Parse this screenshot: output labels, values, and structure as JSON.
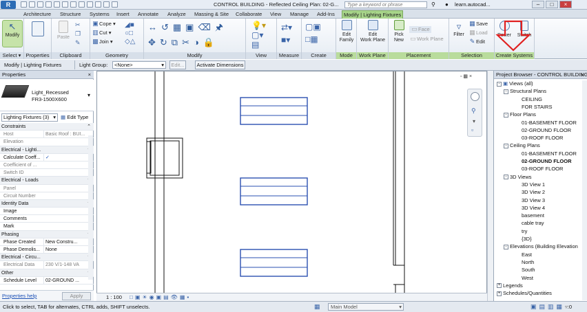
{
  "title": {
    "doc": "CONTROL BUILDING - Reflected Ceiling Plan: 02-G...",
    "search_placeholder": "Type a keyword or phrase",
    "user": "learn.autocad...",
    "app_icon": "R"
  },
  "tabs": [
    "Architecture",
    "Structure",
    "Systems",
    "Insert",
    "Annotate",
    "Analyze",
    "Massing & Site",
    "Collaborate",
    "View",
    "Manage",
    "Add-Ins",
    "Modify | Lighting Fixtures"
  ],
  "ribbon": {
    "select": {
      "modify": "Modify",
      "select": "Select"
    },
    "properties": "Properties",
    "clipboard": {
      "paste": "Paste",
      "title": "Clipboard"
    },
    "geometry": {
      "cope": "Cope",
      "cut": "Cut",
      "join": "Join",
      "title": "Geometry"
    },
    "modify_title": "Modify",
    "view_title": "View",
    "measure_title": "Measure",
    "create_title": "Create",
    "mode": {
      "edit_family_1": "Edit",
      "edit_family_2": "Family",
      "title": "Mode"
    },
    "workplane": {
      "edit_1": "Edit",
      "edit_2": "Work Plane",
      "title": "Work Plane"
    },
    "placement": {
      "pick_1": "Pick",
      "pick_2": "New",
      "face": "Face",
      "workplane": "Work Plane",
      "title": "Placement"
    },
    "selection": {
      "filter": "Filter",
      "save": "Save",
      "load": "Load",
      "edit": "Edit",
      "title": "Selection"
    },
    "createsystems": {
      "power": "Power",
      "switch": "Switch",
      "title": "Create Systems"
    }
  },
  "optionsbar": {
    "context": "Modify | Lighting Fixtures",
    "lightgroup_label": "Light Group:",
    "lightgroup_value": "<None>",
    "edit": "Edit...",
    "activate": "Activate Dimensions"
  },
  "properties": {
    "header": "Properties",
    "type_name_1": "Light_Recessed",
    "type_name_2": "FR3-1500X600",
    "category": "Lighting Fixtures (3)",
    "edit_type": "Edit Type",
    "rows": [
      {
        "k": "Constraints",
        "v": "",
        "group": true
      },
      {
        "k": "Host",
        "v": "Basic Roof : BUI...",
        "dim": true
      },
      {
        "k": "Elevation",
        "v": "",
        "dim": true
      },
      {
        "k": "Electrical - Lighti...",
        "v": "",
        "group": true
      },
      {
        "k": "Calculate Coeff...",
        "v": "✓",
        "check": true
      },
      {
        "k": "Coefficient of ...",
        "v": "",
        "dim": true
      },
      {
        "k": "Switch ID",
        "v": "",
        "dim": true
      },
      {
        "k": "Electrical - Loads",
        "v": "",
        "group": true
      },
      {
        "k": "Panel",
        "v": "",
        "dim": true
      },
      {
        "k": "Circuit Number",
        "v": "",
        "dim": true
      },
      {
        "k": "Identity Data",
        "v": "",
        "group": true
      },
      {
        "k": "Image",
        "v": ""
      },
      {
        "k": "Comments",
        "v": ""
      },
      {
        "k": "Mark",
        "v": ""
      },
      {
        "k": "Phasing",
        "v": "",
        "group": true
      },
      {
        "k": "Phase Created",
        "v": "New Constru..."
      },
      {
        "k": "Phase Demolis...",
        "v": "None"
      },
      {
        "k": "Electrical - Circu...",
        "v": "",
        "group": true
      },
      {
        "k": "Electrical Data",
        "v": "230 V/1-148 VA",
        "dim": true
      },
      {
        "k": "Other",
        "v": "",
        "group": true
      },
      {
        "k": "Schedule Level",
        "v": "02-GROUND ..."
      }
    ],
    "help": "Properties help",
    "apply": "Apply"
  },
  "canvas": {
    "scale": "1 : 100"
  },
  "browser": {
    "header": "Project Browser - CONTROL BUILDING",
    "nodes": [
      {
        "t": "Views (all)",
        "lvl": 0,
        "exp": "-",
        "icon": true
      },
      {
        "t": "Structural Plans",
        "lvl": 1,
        "exp": "-"
      },
      {
        "t": "CEILING",
        "lvl": 2
      },
      {
        "t": "FOR STAIRS",
        "lvl": 2
      },
      {
        "t": "Floor Plans",
        "lvl": 1,
        "exp": "-"
      },
      {
        "t": "01-BASEMENT FLOOR",
        "lvl": 2
      },
      {
        "t": "02-GROUND FLOOR",
        "lvl": 2
      },
      {
        "t": "03-ROOF FLOOR",
        "lvl": 2
      },
      {
        "t": "Ceiling Plans",
        "lvl": 1,
        "exp": "-"
      },
      {
        "t": "01-BASEMENT FLOOR",
        "lvl": 2
      },
      {
        "t": "02-GROUND FLOOR",
        "lvl": 2,
        "bold": true
      },
      {
        "t": "03-ROOF FLOOR",
        "lvl": 2
      },
      {
        "t": "3D Views",
        "lvl": 1,
        "exp": "-"
      },
      {
        "t": "3D View 1",
        "lvl": 2
      },
      {
        "t": "3D View 2",
        "lvl": 2
      },
      {
        "t": "3D View 3",
        "lvl": 2
      },
      {
        "t": "3D View 4",
        "lvl": 2
      },
      {
        "t": "basement",
        "lvl": 2
      },
      {
        "t": "cable tray",
        "lvl": 2
      },
      {
        "t": "try",
        "lvl": 2
      },
      {
        "t": "{3D}",
        "lvl": 2
      },
      {
        "t": "Elevations (Building Elevation",
        "lvl": 1,
        "exp": "-"
      },
      {
        "t": "East",
        "lvl": 2
      },
      {
        "t": "North",
        "lvl": 2
      },
      {
        "t": "South",
        "lvl": 2
      },
      {
        "t": "West",
        "lvl": 2
      },
      {
        "t": "Legends",
        "lvl": 0,
        "exp": "+"
      },
      {
        "t": "Schedules/Quantities",
        "lvl": 0,
        "exp": "+"
      }
    ]
  },
  "status": {
    "text": "Click to select, TAB for alternates, CTRL adds, SHIFT unselects.",
    "model": "Main Model",
    "filter_count": ":0"
  },
  "colors": {
    "accent_green": "#a8d58a",
    "arrow_red": "#e02020",
    "fixture_blue": "#2a4fb0"
  }
}
